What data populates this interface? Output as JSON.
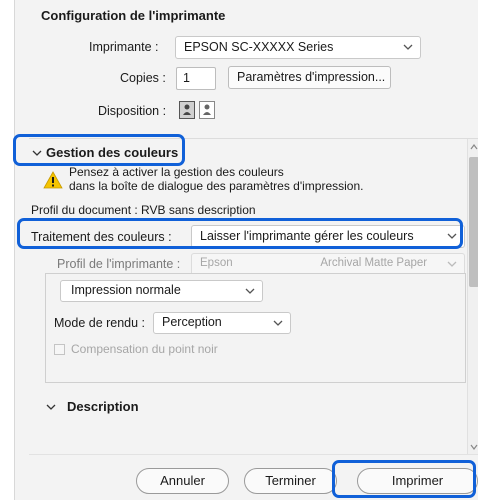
{
  "printer_config": {
    "title": "Configuration de l'imprimante",
    "printer_label": "Imprimante :",
    "printer_value": "EPSON SC-XXXXX Series",
    "copies_label": "Copies :",
    "copies_value": "1",
    "print_params_button": "Paramètres d'impression...",
    "layout_label": "Disposition :"
  },
  "color_management": {
    "title": "Gestion des couleurs",
    "warning_line1": "Pensez à activer la gestion des couleurs",
    "warning_line2": "dans la boîte de dialogue des paramètres d'impression.",
    "doc_profile": "Profil du document : RVB sans description",
    "handling_label": "Traitement des couleurs :",
    "handling_value": "Laisser l'imprimante gérer les couleurs",
    "printer_profile_label": "Profil de l'imprimante :",
    "printer_profile_value_a": "Epson",
    "printer_profile_value_b": "Archival Matte Paper",
    "print_mode_value": "Impression normale",
    "render_mode_label": "Mode de rendu :",
    "render_mode_value": "Perception",
    "black_point_label": "Compensation du point noir"
  },
  "description": {
    "title": "Description"
  },
  "buttons": {
    "cancel": "Annuler",
    "done": "Terminer",
    "print": "Imprimer"
  },
  "colors": {
    "highlight": "#1060d8",
    "warning": "#f5c400"
  }
}
